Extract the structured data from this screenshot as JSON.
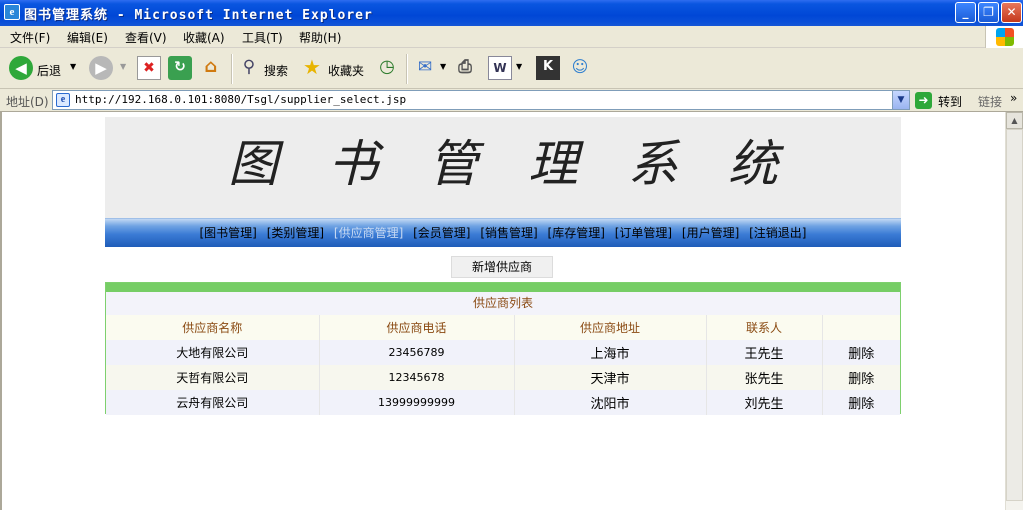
{
  "window": {
    "title": "图书管理系统 - Microsoft Internet Explorer",
    "controls": {
      "minimize": "_",
      "maximize": "❐",
      "close": "✕"
    }
  },
  "menubar": {
    "items": [
      "文件(F)",
      "编辑(E)",
      "查看(V)",
      "收藏(A)",
      "工具(T)",
      "帮助(H)"
    ]
  },
  "toolbar": {
    "back_label": "后退",
    "search_label": "搜索",
    "favorites_label": "收藏夹"
  },
  "addressbar": {
    "label": "地址(D)",
    "url": "http://192.168.0.101:8080/Tsgl/supplier_select.jsp",
    "go_label": "转到",
    "links_label": "链接"
  },
  "page": {
    "banner_title": "图书管理系统",
    "nav": [
      {
        "label": "[图书管理]",
        "active": false
      },
      {
        "label": "[类别管理]",
        "active": false
      },
      {
        "label": "[供应商管理]",
        "active": true
      },
      {
        "label": "[会员管理]",
        "active": false
      },
      {
        "label": "[销售管理]",
        "active": false
      },
      {
        "label": "[库存管理]",
        "active": false
      },
      {
        "label": "[订单管理]",
        "active": false
      },
      {
        "label": "[用户管理]",
        "active": false
      },
      {
        "label": "[注销退出]",
        "active": false
      }
    ],
    "add_button": "新增供应商",
    "table": {
      "caption": "供应商列表",
      "headers": [
        "供应商名称",
        "供应商电话",
        "供应商地址",
        "联系人",
        ""
      ],
      "rows": [
        {
          "name": "大地有限公司",
          "phone": "23456789",
          "address": "上海市",
          "contact": "王先生",
          "action": "删除"
        },
        {
          "name": "天哲有限公司",
          "phone": "12345678",
          "address": "天津市",
          "contact": "张先生",
          "action": "删除"
        },
        {
          "name": "云舟有限公司",
          "phone": "13999999999",
          "address": "沈阳市",
          "contact": "刘先生",
          "action": "删除"
        }
      ]
    }
  },
  "colors": {
    "titlebar": "#0047d6",
    "nav_gradient_dark": "#1f5cb8",
    "panel_border": "#76cd65",
    "header_text": "#8a4a12"
  }
}
